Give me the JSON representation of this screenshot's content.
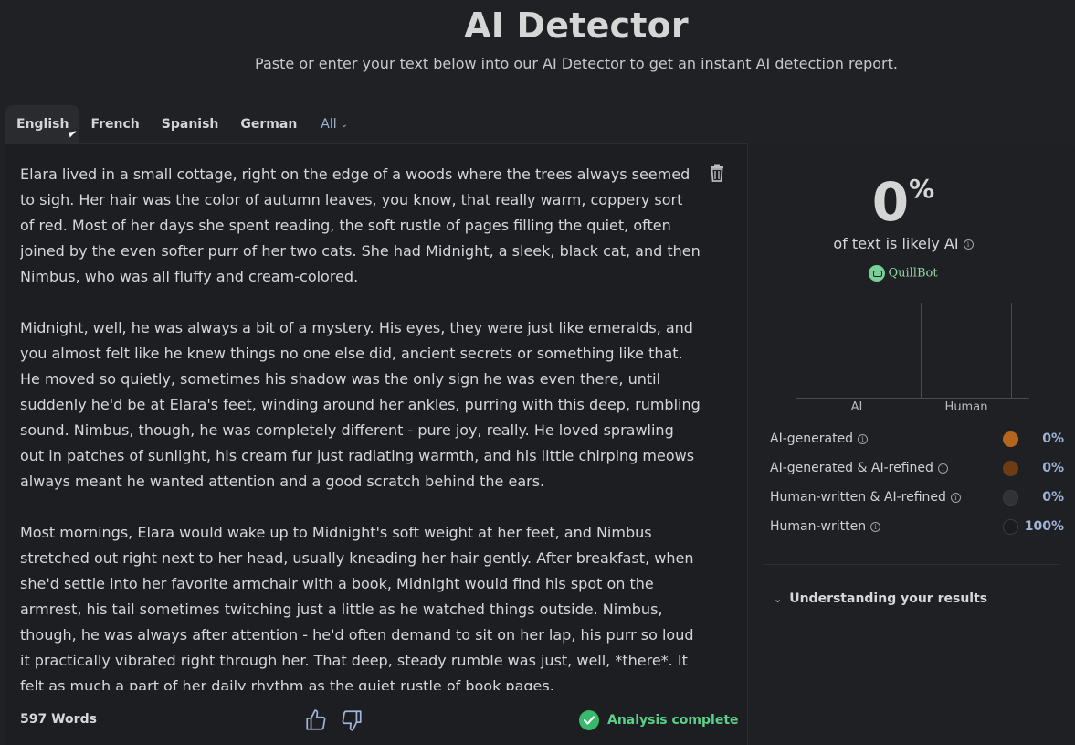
{
  "header": {
    "title": "AI Detector",
    "subtitle": "Paste or enter your text below into our AI Detector to get an instant AI detection report."
  },
  "tabs": [
    "English",
    "French",
    "Spanish",
    "German"
  ],
  "tab_all": "All",
  "editor": {
    "paragraphs": [
      "Elara lived in a small cottage, right on the edge of a woods where the trees always seemed to sigh. Her hair was the color of autumn leaves, you know, that really warm, coppery sort of red. Most of her days she spent reading, the soft rustle of pages filling the quiet, often joined by the even softer purr of her two cats. She had Midnight, a sleek, black cat, and then Nimbus, who was all fluffy and cream-colored.",
      "Midnight, well, he was always a bit of a mystery. His eyes, they were just like emeralds, and you almost felt like he knew things no one else did, ancient secrets or something like that. He moved so quietly, sometimes his shadow was the only sign he was even there, until suddenly he'd be at Elara's feet, winding around her ankles, purring with this deep, rumbling sound. Nimbus, though, he was completely different - pure joy, really. He loved sprawling out in patches of sunlight, his cream fur just radiating warmth, and his little chirping meows always meant he wanted attention and a good scratch behind the ears.",
      "Most mornings, Elara would wake up to Midnight's soft weight at her feet, and Nimbus stretched out right next to her head, usually kneading her hair gently. After breakfast, when she'd settle into her favorite armchair with a book, Midnight would find his spot on the armrest, his tail sometimes twitching just a little as he watched things outside. Nimbus, though, he was always after attention - he'd often demand to sit on her lap, his purr so loud it practically vibrated right through her. That deep, steady rumble was just, well, *there*. It felt as much a part of her daily rhythm as the quiet rustle of book pages."
    ],
    "word_count": "597 Words",
    "status": "Analysis complete"
  },
  "results": {
    "score": "0",
    "score_unit": "%",
    "likely_label": "of text is likely AI",
    "brand": "QuillBot",
    "understanding": "Understanding your results",
    "legend": [
      {
        "label": "AI-generated",
        "value": "0%",
        "color": "#b5651d"
      },
      {
        "label": "AI-generated & AI-refined",
        "value": "0%",
        "color": "#6e3c14"
      },
      {
        "label": "Human-written & AI-refined",
        "value": "0%",
        "color": "#303236"
      },
      {
        "label": "Human-written",
        "value": "100%",
        "color": "#1b1c1f"
      }
    ]
  },
  "chart_data": {
    "type": "bar",
    "categories": [
      "AI",
      "Human"
    ],
    "values": [
      0,
      100
    ],
    "ylim": [
      0,
      100
    ],
    "title": "",
    "xlabel": "",
    "ylabel": "",
    "grid": false
  },
  "colors": {
    "accent": "#9fb4d8",
    "success": "#38b96c",
    "background": "#202124"
  }
}
